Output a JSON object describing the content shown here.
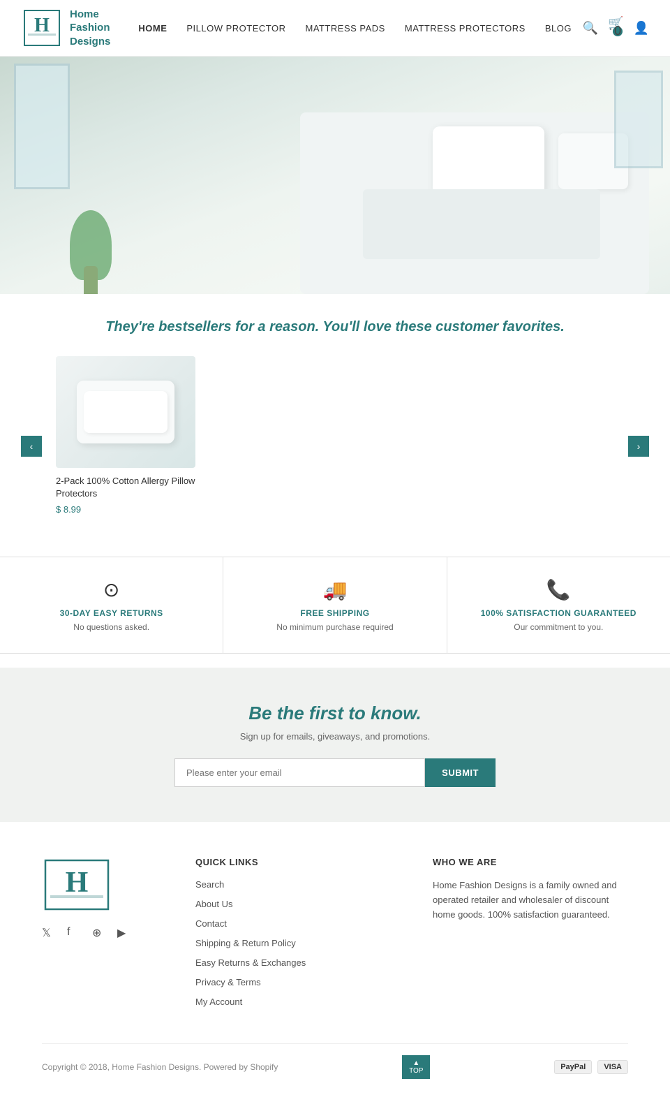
{
  "header": {
    "logo_text": "Home\nFashion\nDesigns",
    "nav_items": [
      {
        "label": "HOME",
        "active": true
      },
      {
        "label": "PILLOW PROTECTOR",
        "active": false
      },
      {
        "label": "MATTRESS PADS",
        "active": false
      },
      {
        "label": "MATTRESS PROTECTORS",
        "active": false
      },
      {
        "label": "BLOG",
        "active": false
      }
    ],
    "cart_count": "0"
  },
  "tagline": {
    "text": "They're bestsellers for a reason. You'll love these customer favorites."
  },
  "product": {
    "title": "2-Pack 100% Cotton Allergy Pillow Protectors",
    "price": "$ 8.99"
  },
  "carousel": {
    "prev_label": "‹",
    "next_label": "›"
  },
  "features": [
    {
      "icon": "$",
      "title": "30-DAY EASY RETURNS",
      "desc": "No questions asked."
    },
    {
      "icon": "🚚",
      "title": "FREE SHIPPING",
      "desc": "No minimum purchase required"
    },
    {
      "icon": "📞",
      "title": "100% Satisfaction Guaranteed",
      "desc": "Our commitment to you."
    }
  ],
  "newsletter": {
    "heading": "Be the first to know.",
    "subtext": "Sign up for emails, giveaways, and promotions.",
    "placeholder": "Please enter your email",
    "button_label": "SUBMIT"
  },
  "footer": {
    "quick_links_heading": "QUICK LINKS",
    "quick_links": [
      {
        "label": "Search"
      },
      {
        "label": "About Us"
      },
      {
        "label": "Contact"
      },
      {
        "label": "Shipping & Return Policy"
      },
      {
        "label": "Easy Returns & Exchanges"
      },
      {
        "label": "Privacy & Terms"
      },
      {
        "label": "My Account"
      }
    ],
    "who_heading": "WHO WE ARE",
    "who_text": "Home Fashion Designs is a family owned and operated retailer and wholesaler of discount home goods. 100% satisfaction guaranteed.",
    "copyright": "Copyright © 2018,   Home Fashion Designs. Powered by Shopify",
    "back_to_top": "▲\nTOP",
    "payment_icons": [
      "PayPal",
      "VISA"
    ]
  }
}
